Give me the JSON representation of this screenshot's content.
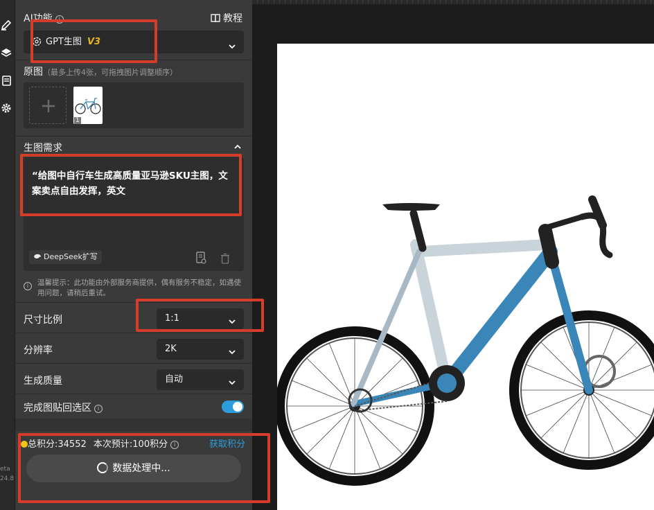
{
  "rail": {
    "version_line1": "eta",
    "version_line2": "24.8"
  },
  "ai_section": {
    "title": "AI功能",
    "tutorial_label": "教程",
    "model_name": "GPT生图",
    "model_version": "V3"
  },
  "source": {
    "title": "原图",
    "subtitle": "（最多上传4张，可拖拽图片调整顺序）",
    "thumb_index": "1"
  },
  "prompt": {
    "title": "生图需求",
    "text": "“给图中自行车生成高质量亚马逊SKU主图，文案卖点自由发挥，英文",
    "deepseek_label": "DeepSeek扩写",
    "warning": "温馨提示：此功能由外部服务商提供，偶有服务不稳定，如遇使用问题，请稍后重试。"
  },
  "settings": {
    "ratio_label": "尺寸比例",
    "ratio_value": "1:1",
    "resolution_label": "分辨率",
    "resolution_value": "2K",
    "quality_label": "生成质量",
    "quality_value": "自动",
    "paste_back_label": "完成图贴回选区"
  },
  "footer": {
    "points_text": "总积分:34552",
    "estimate_text": "本次预计:100积分",
    "get_points_label": "获取积分",
    "processing_label": "数据处理中..."
  },
  "colors": {
    "accent": "#2d9cdb",
    "model_version": "#e6b422",
    "highlight_box": "#d63c2a",
    "toggle_on": "#2d9cdb",
    "frame_blue": "#3a86b8",
    "frame_silver": "#c9d3da"
  },
  "icons": {
    "brush": "brush-icon",
    "layers": "layers-icon",
    "document": "document-icon",
    "settings": "gear-icon",
    "book": "book-icon",
    "openai": "openai-logo-icon",
    "plus": "plus-icon",
    "collapse": "chevron-up-icon",
    "dropdown": "chevron-down-icon",
    "deepseek": "deepseek-whale-icon",
    "history": "history-doc-icon",
    "trash": "trash-icon",
    "info": "info-icon",
    "coin": "coin-icon",
    "spinner": "spinner-icon"
  }
}
